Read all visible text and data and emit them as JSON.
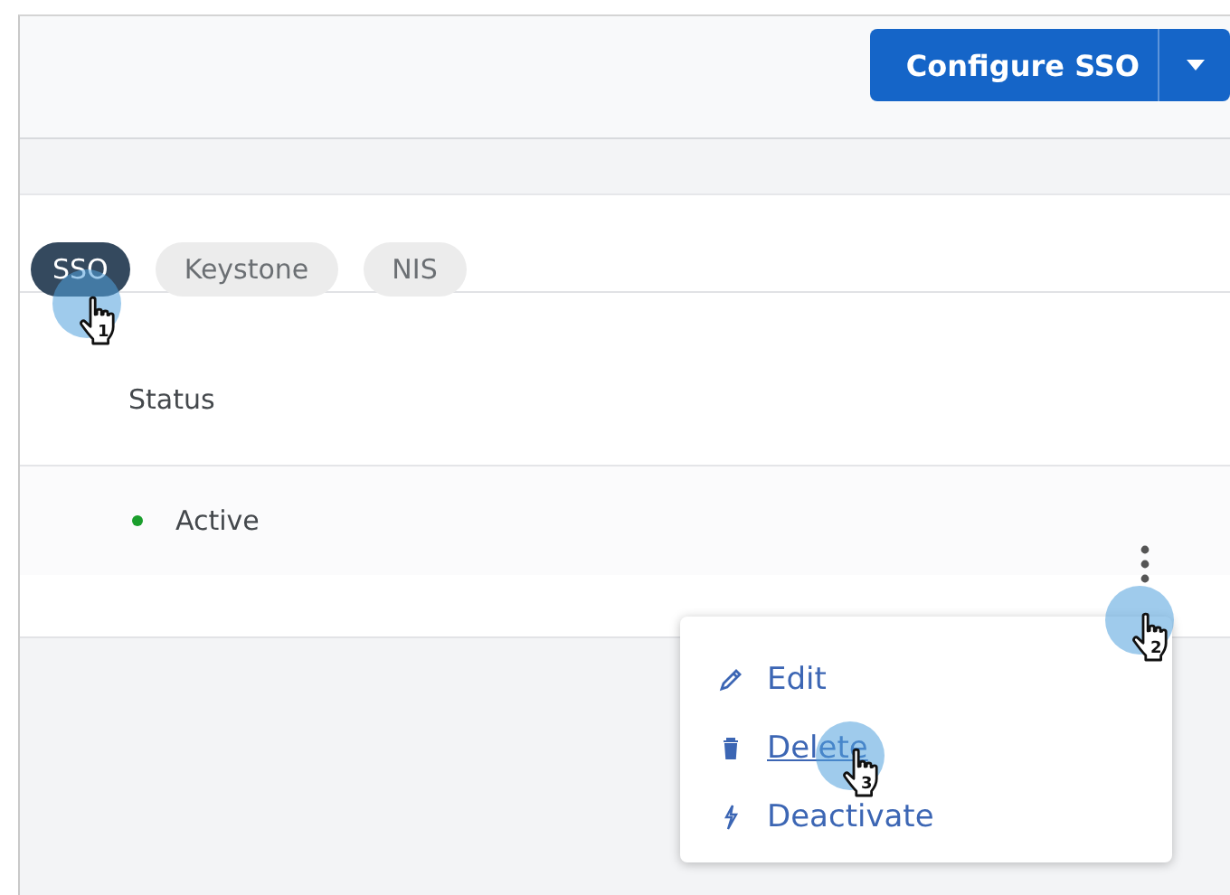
{
  "header": {
    "primary_button": "Configure SSO"
  },
  "tabs": [
    {
      "label": "SSO",
      "selected": true
    },
    {
      "label": "Keystone",
      "selected": false
    },
    {
      "label": "NIS",
      "selected": false
    }
  ],
  "table": {
    "columns": [
      "Status"
    ],
    "rows": [
      {
        "status": "Active",
        "color": "#1a9e2c"
      }
    ]
  },
  "menu": {
    "items": [
      {
        "label": "Edit",
        "kind": "edit",
        "selected": false
      },
      {
        "label": "Delete",
        "kind": "delete",
        "selected": true
      },
      {
        "label": "Deactivate",
        "kind": "deactivate",
        "selected": false
      }
    ]
  },
  "callouts": [
    {
      "label": "1"
    },
    {
      "label": "2"
    },
    {
      "label": "3"
    }
  ]
}
